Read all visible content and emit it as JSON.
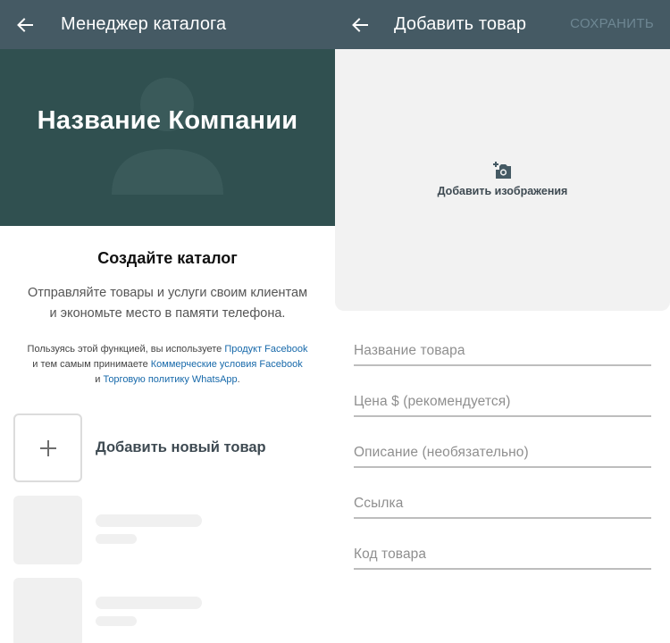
{
  "left": {
    "appbar": {
      "title": "Менеджер каталога"
    },
    "cover": {
      "company_name": "Название Компании"
    },
    "create": {
      "title": "Создайте каталог",
      "description_line1": "Отправляйте товары и услуги своим клиентам",
      "description_line2": "и экономьте место в памяти телефона."
    },
    "legal": {
      "text1": "Пользуясь этой функцией, вы используете ",
      "link1": "Продукт Facebook",
      "text2": "и тем самым принимаете ",
      "link2": "Коммерческие условия Facebook",
      "text3": "и ",
      "link3": "Торговую политику WhatsApp",
      "text4": "."
    },
    "add_item": {
      "label": "Добавить новый товар",
      "icon": "plus-icon"
    }
  },
  "right": {
    "appbar": {
      "title": "Добавить товар",
      "save_label": "СОХРАНИТЬ"
    },
    "image": {
      "label": "Добавить изображения",
      "icon": "add-photo-icon"
    },
    "fields": [
      {
        "placeholder": "Название товара"
      },
      {
        "placeholder": "Цена $ (рекомендуется)"
      },
      {
        "placeholder": "Описание (необязательно)"
      },
      {
        "placeholder": "Ссылка"
      },
      {
        "placeholder": "Код товара"
      }
    ]
  },
  "colors": {
    "appbar": "#455a64",
    "cover": "#305050",
    "link": "#1769aa",
    "placeholder_block": "#f0f0f0"
  }
}
